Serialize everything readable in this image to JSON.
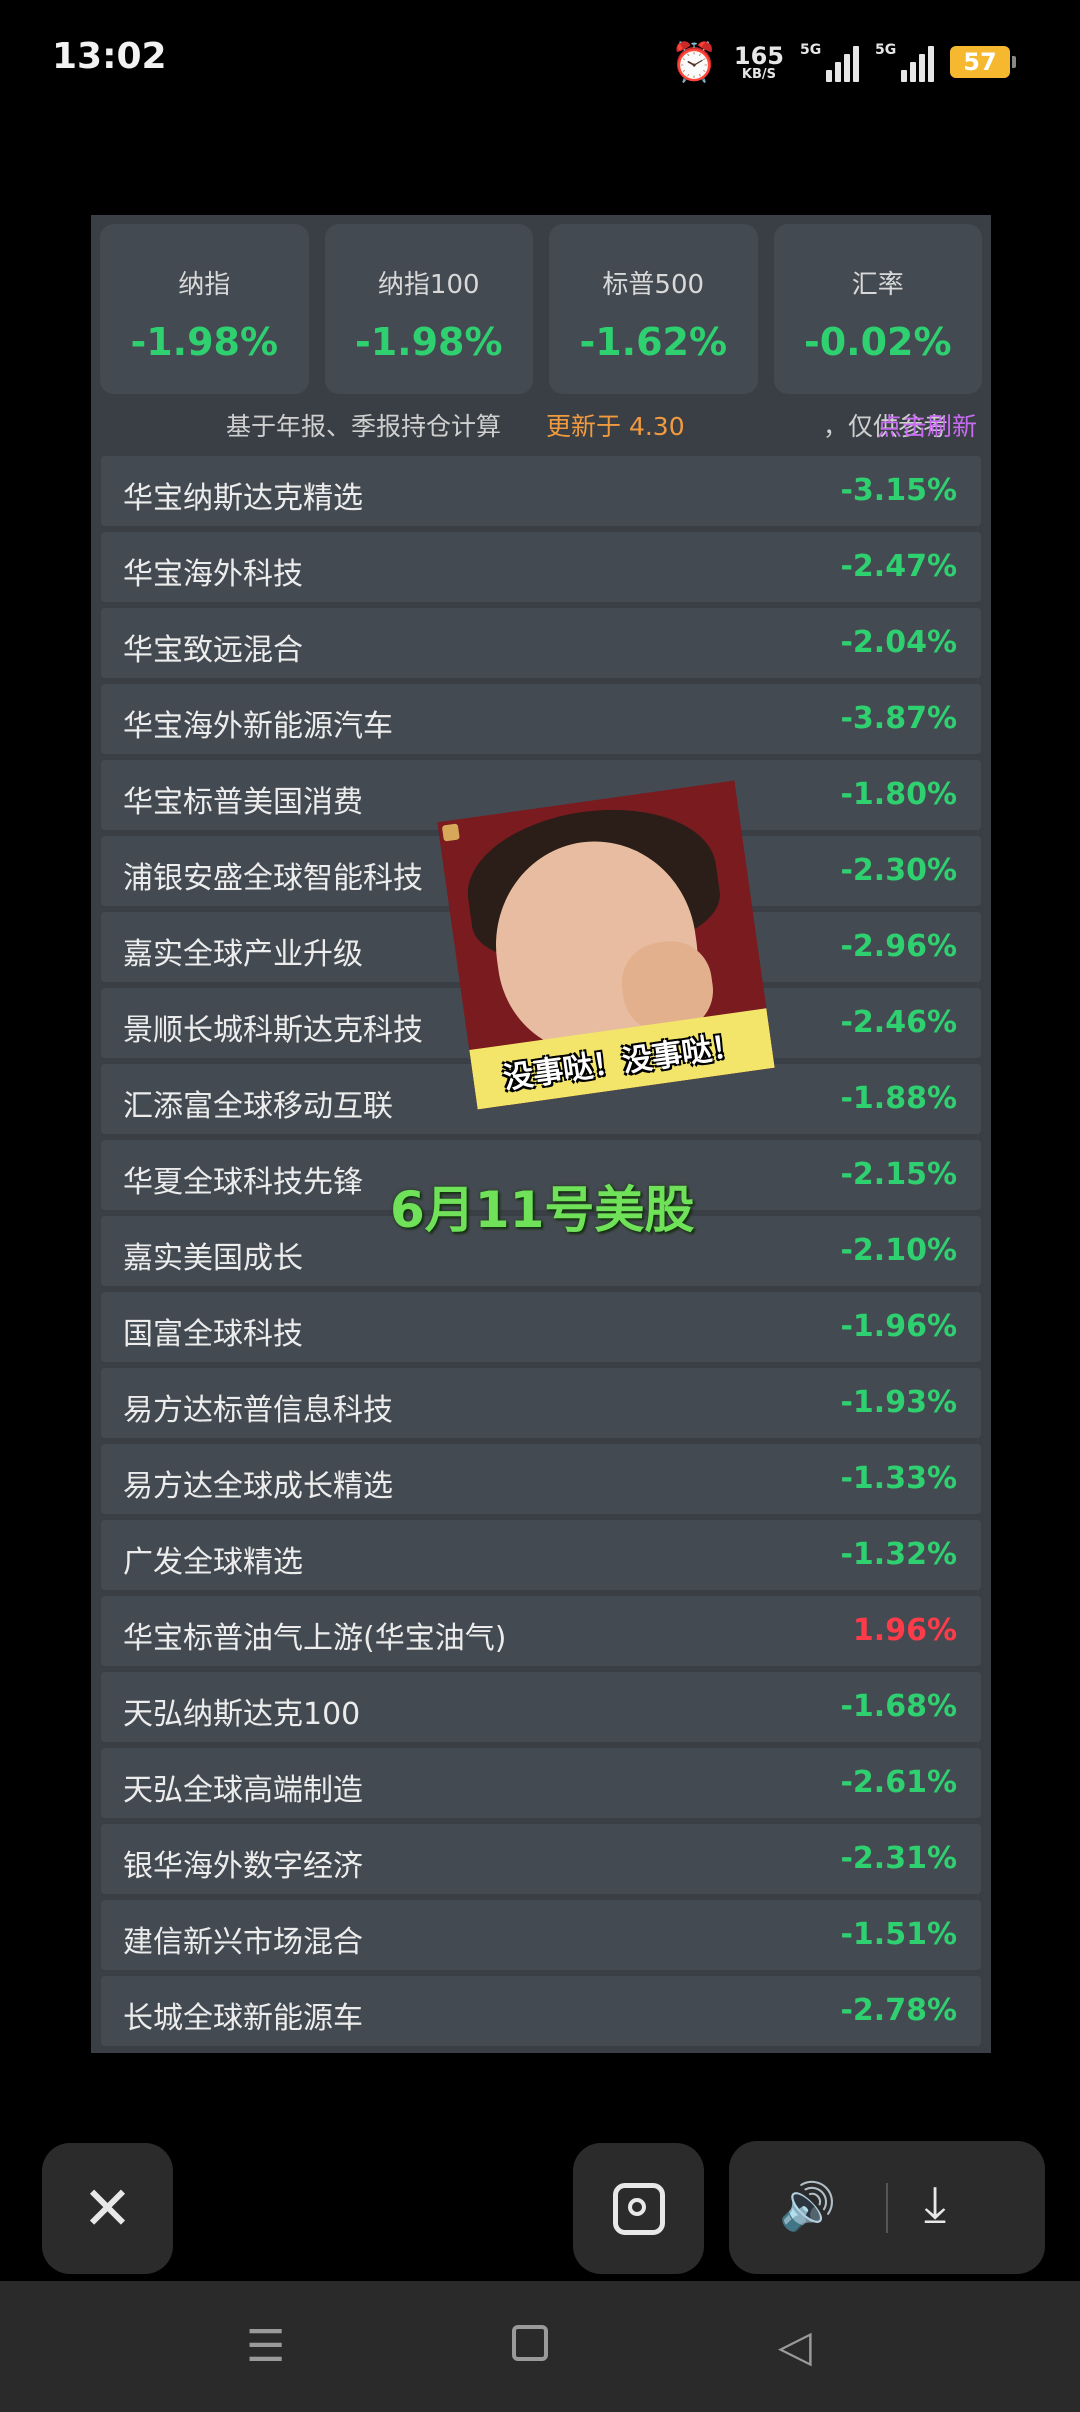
{
  "status_bar": {
    "time": "13:02",
    "speed_value": "165",
    "speed_unit": "KB/S",
    "signal1_label": "5G",
    "signal2_label": "5G",
    "battery": "57"
  },
  "index_cards": [
    {
      "name": "纳指",
      "value": "-1.98%"
    },
    {
      "name": "纳指100",
      "value": "-1.98%"
    },
    {
      "name": "标普500",
      "value": "-1.62%"
    },
    {
      "name": "汇率",
      "value": "-0.02%"
    }
  ],
  "info": {
    "basis": "基于年报、季报持仓计算",
    "updated": "更新于 4.30",
    "reference": "，仅供参考",
    "refresh": "点击刷新"
  },
  "funds": [
    {
      "name": "华宝纳斯达克精选",
      "change": "-3.15%"
    },
    {
      "name": "华宝海外科技",
      "change": "-2.47%"
    },
    {
      "name": "华宝致远混合",
      "change": "-2.04%"
    },
    {
      "name": "华宝海外新能源汽车",
      "change": "-3.87%"
    },
    {
      "name": "华宝标普美国消费",
      "change": "-1.80%"
    },
    {
      "name": "浦银安盛全球智能科技",
      "change": "-2.30%"
    },
    {
      "name": "嘉实全球产业升级",
      "change": "-2.96%"
    },
    {
      "name": "景顺长城科斯达克科技",
      "change": "-2.46%"
    },
    {
      "name": "汇添富全球移动互联",
      "change": "-1.88%"
    },
    {
      "name": "华夏全球科技先锋",
      "change": "-2.15%"
    },
    {
      "name": "嘉实美国成长",
      "change": "-2.10%"
    },
    {
      "name": "国富全球科技",
      "change": "-1.96%"
    },
    {
      "name": "易方达标普信息科技",
      "change": "-1.93%"
    },
    {
      "name": "易方达全球成长精选",
      "change": "-1.33%"
    },
    {
      "name": "广发全球精选",
      "change": "-1.32%"
    },
    {
      "name": "华宝标普油气上游(华宝油气)",
      "change": "1.96%",
      "up": true
    },
    {
      "name": "天弘纳斯达克100",
      "change": "-1.68%"
    },
    {
      "name": "天弘全球高端制造",
      "change": "-2.61%"
    },
    {
      "name": "银华海外数字经济",
      "change": "-2.31%"
    },
    {
      "name": "建信新兴市场混合",
      "change": "-1.51%"
    },
    {
      "name": "长城全球新能源车",
      "change": "-2.78%"
    }
  ],
  "overlay": {
    "sticker_caption": "没事哒！没事哒！",
    "video_title": "6月11号美股"
  },
  "controls": {
    "close_icon": "close-icon",
    "scan_icon": "scan-icon",
    "volume_icon": "volume-icon",
    "download_icon": "download-icon"
  },
  "colors": {
    "down": "#2fd070",
    "up": "#ff3b4a",
    "updated": "#f19a3e",
    "refresh": "#c76bf0",
    "battery": "#f5b82e"
  }
}
